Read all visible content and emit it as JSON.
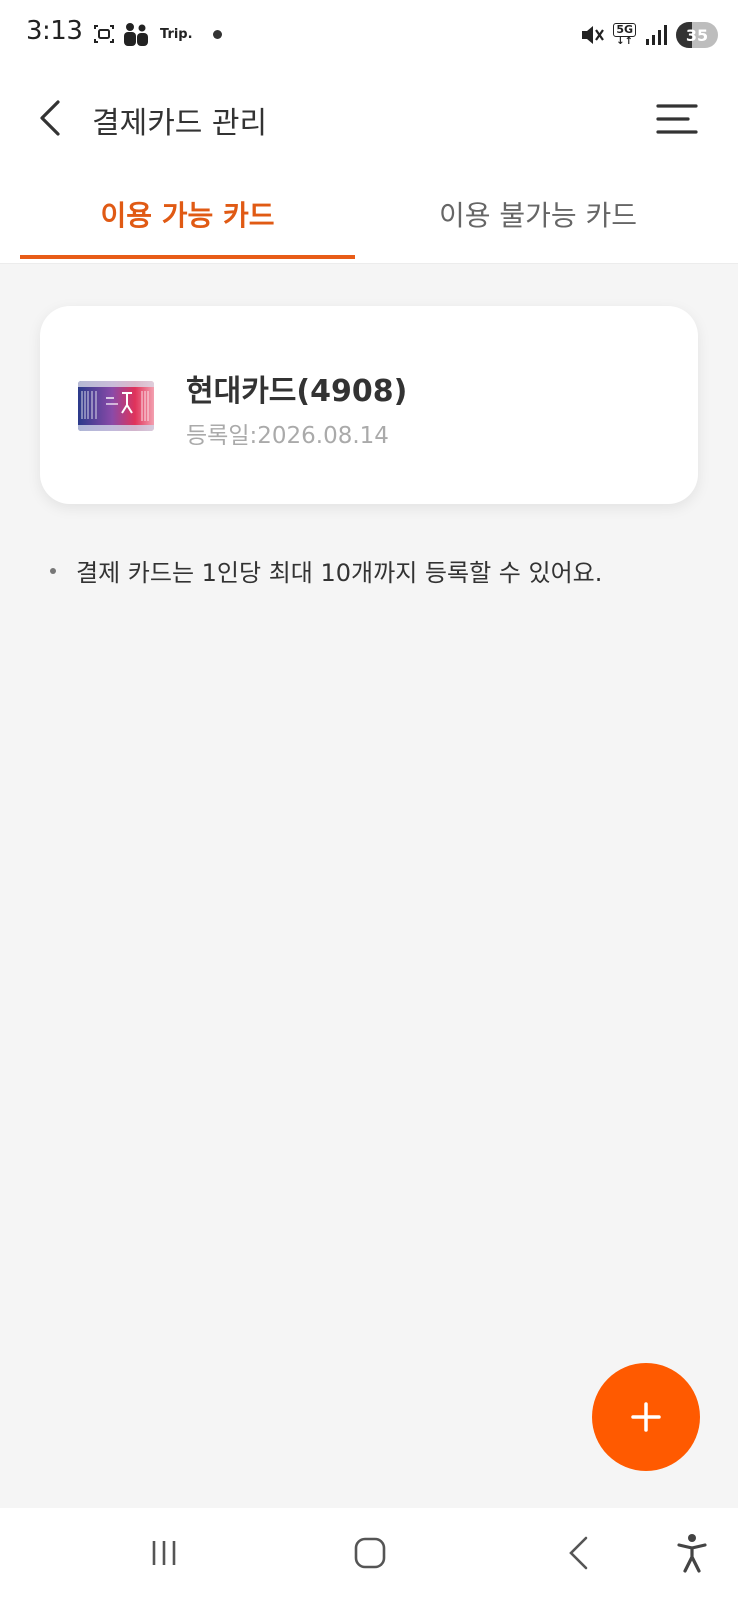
{
  "status_bar": {
    "time": "3:13",
    "trip_label": "Trip.",
    "network": "5G",
    "battery": "35"
  },
  "header": {
    "title": "결제카드 관리"
  },
  "tabs": [
    {
      "label": "이용 가능 카드",
      "active": true
    },
    {
      "label": "이용 불가능 카드",
      "active": false
    }
  ],
  "cards": [
    {
      "name": "현대카드(4908)",
      "registered": "등록일:2026.08.14"
    }
  ],
  "notice": "결제 카드는 1인당 최대 10개까지 등록할 수 있어요.",
  "colors": {
    "accent": "#e85c18",
    "fab": "#ff5a00",
    "background": "#f5f5f5"
  }
}
